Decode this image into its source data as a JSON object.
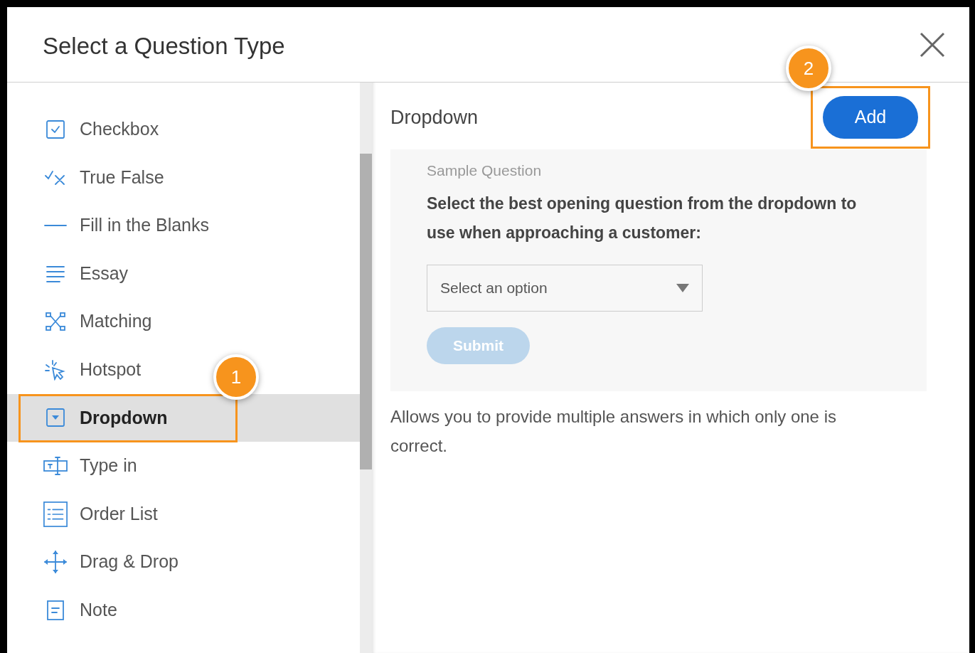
{
  "dialog": {
    "title": "Select a Question Type"
  },
  "question_types": [
    {
      "kind": "checkbox",
      "label": "Checkbox",
      "selected": false
    },
    {
      "kind": "true_false",
      "label": "True False",
      "selected": false
    },
    {
      "kind": "fill_blanks",
      "label": "Fill in the Blanks",
      "selected": false
    },
    {
      "kind": "essay",
      "label": "Essay",
      "selected": false
    },
    {
      "kind": "matching",
      "label": "Matching",
      "selected": false
    },
    {
      "kind": "hotspot",
      "label": "Hotspot",
      "selected": false
    },
    {
      "kind": "dropdown",
      "label": "Dropdown",
      "selected": true
    },
    {
      "kind": "type_in",
      "label": "Type in",
      "selected": false
    },
    {
      "kind": "order_list",
      "label": "Order List",
      "selected": false
    },
    {
      "kind": "drag_drop",
      "label": "Drag & Drop",
      "selected": false
    },
    {
      "kind": "note",
      "label": "Note",
      "selected": false
    }
  ],
  "preview": {
    "heading": "Dropdown",
    "add_button": "Add",
    "sample": {
      "caption": "Sample Question",
      "question": "Select the best opening question from the dropdown to use when approaching a customer:",
      "select": {
        "placeholder": "Select an option"
      },
      "submit_button": "Submit"
    },
    "description": "Allows you to provide multiple answers in which only one is correct."
  },
  "callouts": [
    {
      "label": "1"
    },
    {
      "label": "2"
    }
  ]
}
